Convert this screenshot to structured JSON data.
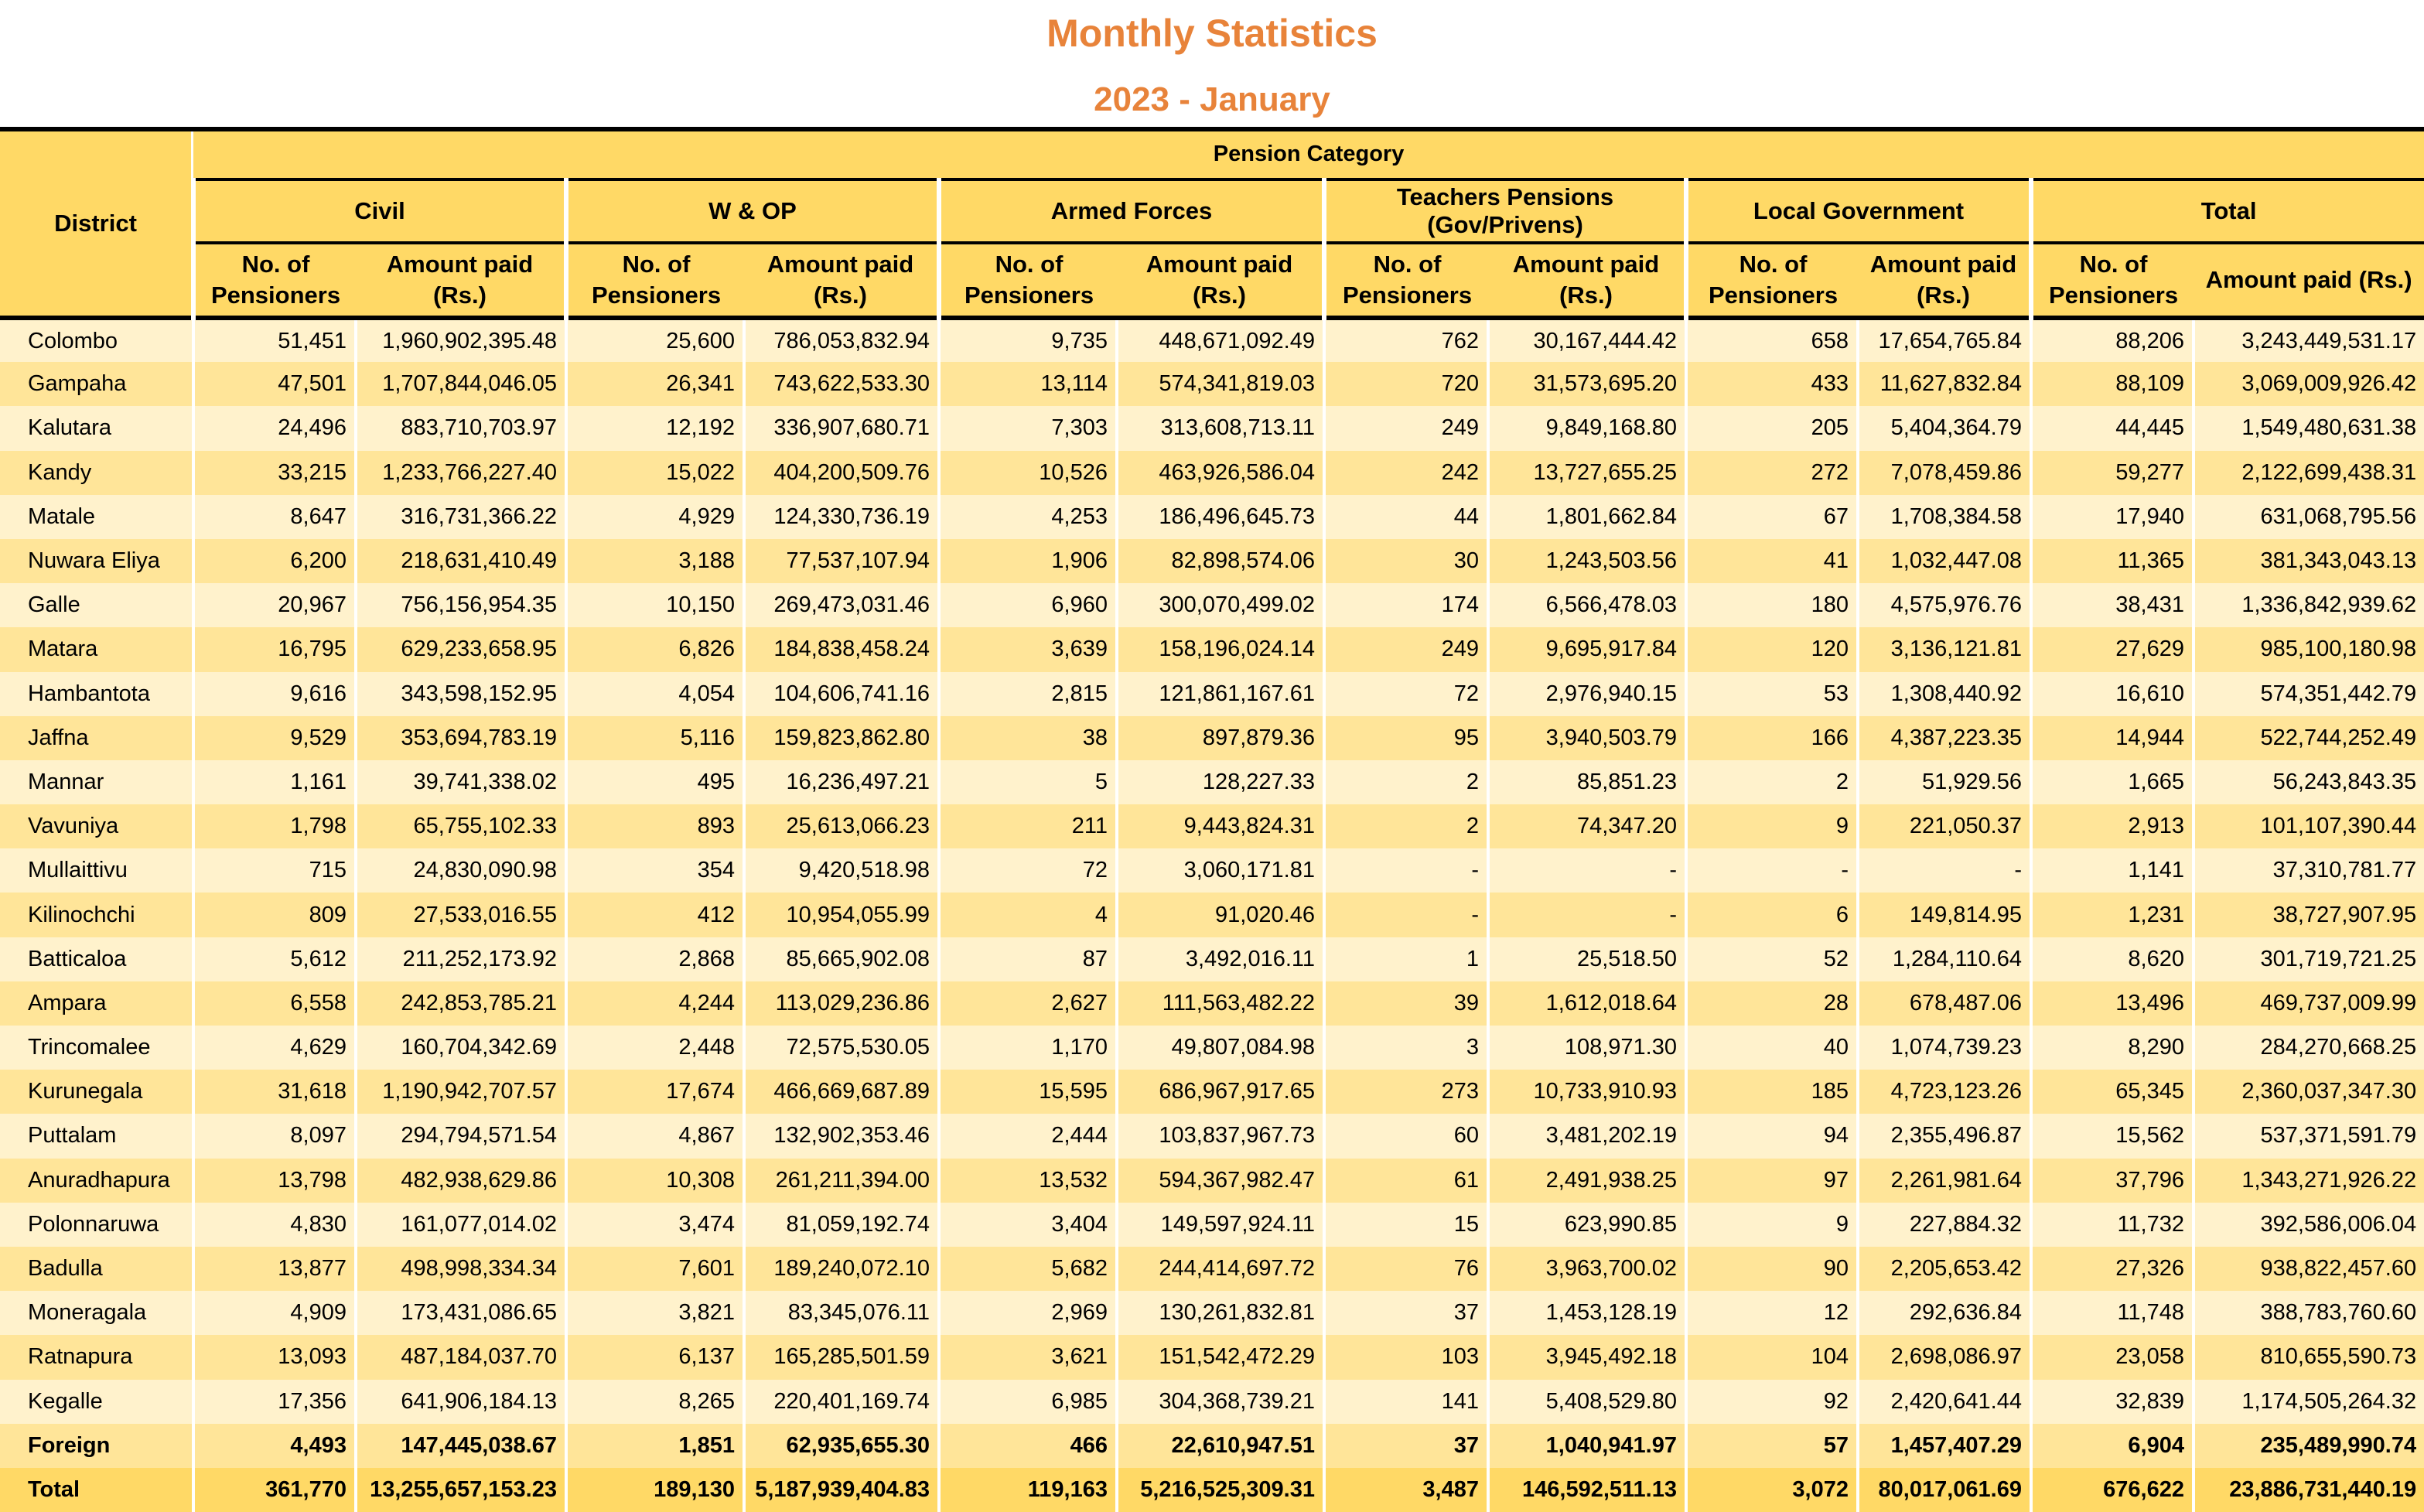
{
  "title": "Monthly Statistics",
  "subtitle": "2023 - January",
  "header": {
    "district": "District",
    "pension_category": "Pension Category",
    "groups": [
      "Civil",
      "W & OP",
      "Armed Forces",
      "Teachers Pensions\n(Gov/Privens)",
      "Local Government",
      "Total"
    ],
    "sub": {
      "pensioners": "No. of\nPensioners",
      "amount": "Amount paid\n(Rs.)",
      "amount_total": "Amount paid (Rs.)"
    }
  },
  "colors": {
    "title": "#e8833a",
    "header_bg": "#ffd966",
    "row_light": "#fff2cc",
    "row_dark": "#ffe599"
  },
  "rows": [
    [
      "Colombo",
      "51,451",
      "1,960,902,395.48",
      "25,600",
      "786,053,832.94",
      "9,735",
      "448,671,092.49",
      "762",
      "30,167,444.42",
      "658",
      "17,654,765.84",
      "88,206",
      "3,243,449,531.17"
    ],
    [
      "Gampaha",
      "47,501",
      "1,707,844,046.05",
      "26,341",
      "743,622,533.30",
      "13,114",
      "574,341,819.03",
      "720",
      "31,573,695.20",
      "433",
      "11,627,832.84",
      "88,109",
      "3,069,009,926.42"
    ],
    [
      "Kalutara",
      "24,496",
      "883,710,703.97",
      "12,192",
      "336,907,680.71",
      "7,303",
      "313,608,713.11",
      "249",
      "9,849,168.80",
      "205",
      "5,404,364.79",
      "44,445",
      "1,549,480,631.38"
    ],
    [
      "Kandy",
      "33,215",
      "1,233,766,227.40",
      "15,022",
      "404,200,509.76",
      "10,526",
      "463,926,586.04",
      "242",
      "13,727,655.25",
      "272",
      "7,078,459.86",
      "59,277",
      "2,122,699,438.31"
    ],
    [
      "Matale",
      "8,647",
      "316,731,366.22",
      "4,929",
      "124,330,736.19",
      "4,253",
      "186,496,645.73",
      "44",
      "1,801,662.84",
      "67",
      "1,708,384.58",
      "17,940",
      "631,068,795.56"
    ],
    [
      "Nuwara Eliya",
      "6,200",
      "218,631,410.49",
      "3,188",
      "77,537,107.94",
      "1,906",
      "82,898,574.06",
      "30",
      "1,243,503.56",
      "41",
      "1,032,447.08",
      "11,365",
      "381,343,043.13"
    ],
    [
      "Galle",
      "20,967",
      "756,156,954.35",
      "10,150",
      "269,473,031.46",
      "6,960",
      "300,070,499.02",
      "174",
      "6,566,478.03",
      "180",
      "4,575,976.76",
      "38,431",
      "1,336,842,939.62"
    ],
    [
      "Matara",
      "16,795",
      "629,233,658.95",
      "6,826",
      "184,838,458.24",
      "3,639",
      "158,196,024.14",
      "249",
      "9,695,917.84",
      "120",
      "3,136,121.81",
      "27,629",
      "985,100,180.98"
    ],
    [
      "Hambantota",
      "9,616",
      "343,598,152.95",
      "4,054",
      "104,606,741.16",
      "2,815",
      "121,861,167.61",
      "72",
      "2,976,940.15",
      "53",
      "1,308,440.92",
      "16,610",
      "574,351,442.79"
    ],
    [
      "Jaffna",
      "9,529",
      "353,694,783.19",
      "5,116",
      "159,823,862.80",
      "38",
      "897,879.36",
      "95",
      "3,940,503.79",
      "166",
      "4,387,223.35",
      "14,944",
      "522,744,252.49"
    ],
    [
      "Mannar",
      "1,161",
      "39,741,338.02",
      "495",
      "16,236,497.21",
      "5",
      "128,227.33",
      "2",
      "85,851.23",
      "2",
      "51,929.56",
      "1,665",
      "56,243,843.35"
    ],
    [
      "Vavuniya",
      "1,798",
      "65,755,102.33",
      "893",
      "25,613,066.23",
      "211",
      "9,443,824.31",
      "2",
      "74,347.20",
      "9",
      "221,050.37",
      "2,913",
      "101,107,390.44"
    ],
    [
      "Mullaittivu",
      "715",
      "24,830,090.98",
      "354",
      "9,420,518.98",
      "72",
      "3,060,171.81",
      "-",
      "-",
      "-",
      "-",
      "1,141",
      "37,310,781.77"
    ],
    [
      "Kilinochchi",
      "809",
      "27,533,016.55",
      "412",
      "10,954,055.99",
      "4",
      "91,020.46",
      "-",
      "-",
      "6",
      "149,814.95",
      "1,231",
      "38,727,907.95"
    ],
    [
      "Batticaloa",
      "5,612",
      "211,252,173.92",
      "2,868",
      "85,665,902.08",
      "87",
      "3,492,016.11",
      "1",
      "25,518.50",
      "52",
      "1,284,110.64",
      "8,620",
      "301,719,721.25"
    ],
    [
      "Ampara",
      "6,558",
      "242,853,785.21",
      "4,244",
      "113,029,236.86",
      "2,627",
      "111,563,482.22",
      "39",
      "1,612,018.64",
      "28",
      "678,487.06",
      "13,496",
      "469,737,009.99"
    ],
    [
      "Trincomalee",
      "4,629",
      "160,704,342.69",
      "2,448",
      "72,575,530.05",
      "1,170",
      "49,807,084.98",
      "3",
      "108,971.30",
      "40",
      "1,074,739.23",
      "8,290",
      "284,270,668.25"
    ],
    [
      "Kurunegala",
      "31,618",
      "1,190,942,707.57",
      "17,674",
      "466,669,687.89",
      "15,595",
      "686,967,917.65",
      "273",
      "10,733,910.93",
      "185",
      "4,723,123.26",
      "65,345",
      "2,360,037,347.30"
    ],
    [
      "Puttalam",
      "8,097",
      "294,794,571.54",
      "4,867",
      "132,902,353.46",
      "2,444",
      "103,837,967.73",
      "60",
      "3,481,202.19",
      "94",
      "2,355,496.87",
      "15,562",
      "537,371,591.79"
    ],
    [
      "Anuradhapura",
      "13,798",
      "482,938,629.86",
      "10,308",
      "261,211,394.00",
      "13,532",
      "594,367,982.47",
      "61",
      "2,491,938.25",
      "97",
      "2,261,981.64",
      "37,796",
      "1,343,271,926.22"
    ],
    [
      "Polonnaruwa",
      "4,830",
      "161,077,014.02",
      "3,474",
      "81,059,192.74",
      "3,404",
      "149,597,924.11",
      "15",
      "623,990.85",
      "9",
      "227,884.32",
      "11,732",
      "392,586,006.04"
    ],
    [
      "Badulla",
      "13,877",
      "498,998,334.34",
      "7,601",
      "189,240,072.10",
      "5,682",
      "244,414,697.72",
      "76",
      "3,963,700.02",
      "90",
      "2,205,653.42",
      "27,326",
      "938,822,457.60"
    ],
    [
      "Moneragala",
      "4,909",
      "173,431,086.65",
      "3,821",
      "83,345,076.11",
      "2,969",
      "130,261,832.81",
      "37",
      "1,453,128.19",
      "12",
      "292,636.84",
      "11,748",
      "388,783,760.60"
    ],
    [
      "Ratnapura",
      "13,093",
      "487,184,037.70",
      "6,137",
      "165,285,501.59",
      "3,621",
      "151,542,472.29",
      "103",
      "3,945,492.18",
      "104",
      "2,698,086.97",
      "23,058",
      "810,655,590.73"
    ],
    [
      "Kegalle",
      "17,356",
      "641,906,184.13",
      "8,265",
      "220,401,169.74",
      "6,985",
      "304,368,739.21",
      "141",
      "5,408,529.80",
      "92",
      "2,420,641.44",
      "32,839",
      "1,174,505,264.32"
    ]
  ],
  "foreign": [
    "Foreign",
    "4,493",
    "147,445,038.67",
    "1,851",
    "62,935,655.30",
    "466",
    "22,610,947.51",
    "37",
    "1,040,941.97",
    "57",
    "1,457,407.29",
    "6,904",
    "235,489,990.74"
  ],
  "total": [
    "Total",
    "361,770",
    "13,255,657,153.23",
    "189,130",
    "5,187,939,404.83",
    "119,163",
    "5,216,525,309.31",
    "3,487",
    "146,592,511.13",
    "3,072",
    "80,017,061.69",
    "676,622",
    "23,886,731,440.19"
  ]
}
